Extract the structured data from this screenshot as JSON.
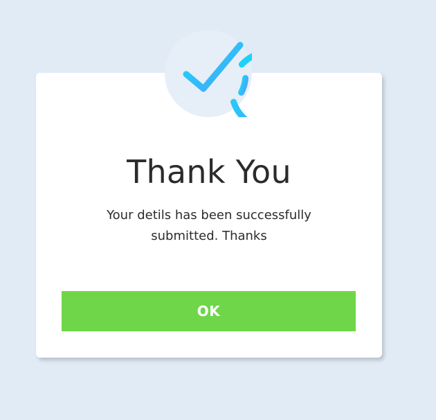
{
  "dialog": {
    "icon": "check-circle-icon",
    "title": "Thank You",
    "message": "Your detils has been successfully submitted. Thanks",
    "ok_label": "OK"
  },
  "colors": {
    "background": "#e1ebf6",
    "card": "#ffffff",
    "button": "#6fd649",
    "icon_gradient_start": "#18d8fb",
    "icon_gradient_end": "#4ba3f7",
    "text": "#2b2b2b"
  }
}
